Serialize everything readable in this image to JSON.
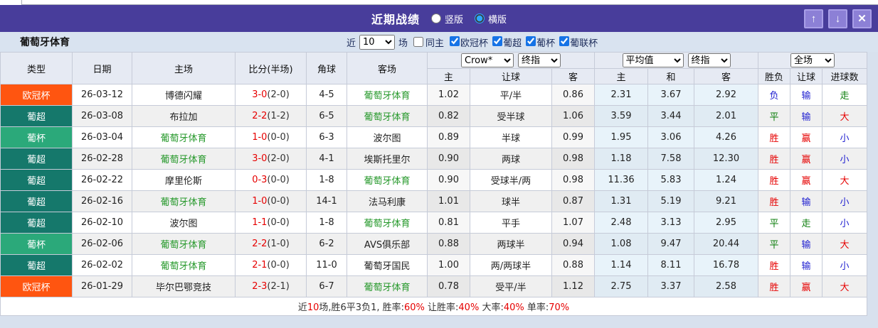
{
  "titlebar": {
    "title": "近期战绩",
    "radio_vertical": "竖版",
    "radio_horizontal": "横版",
    "selected_layout": "横版",
    "icons": {
      "up": "↑",
      "down": "↓",
      "close": "✕"
    },
    "bar_color": "#483d9b"
  },
  "filterbar": {
    "team": "葡萄牙体育",
    "near_label": "近",
    "count_value": "10",
    "matches_label": "场",
    "same_home_label": "同主",
    "same_home_checked": false,
    "leagues": [
      {
        "label": "欧冠杯",
        "checked": true
      },
      {
        "label": "葡超",
        "checked": true
      },
      {
        "label": "葡杯",
        "checked": true
      },
      {
        "label": "葡联杯",
        "checked": true
      }
    ]
  },
  "table": {
    "headers": {
      "type": "类型",
      "date": "日期",
      "home": "主场",
      "score": "比分(半场)",
      "corner": "角球",
      "away": "客场",
      "sub": [
        "主",
        "让球",
        "客",
        "主",
        "和",
        "客",
        "胜负",
        "让球",
        "进球数"
      ]
    },
    "selects": {
      "book": "Crow*",
      "book_ref": "终指",
      "avg": "平均值",
      "avg_ref": "终指",
      "scope": "全场"
    },
    "type_colors": {
      "欧冠杯": "#ff5510",
      "葡超": "#15786b",
      "葡杯": "#2ba97a"
    },
    "result_colors": {
      "red": "#e60000",
      "green": "#0a7d0a",
      "blue": "#2020d0"
    },
    "focus_team_color": "#27992c",
    "score_color": "#e60000",
    "rows": [
      {
        "league": "欧冠杯",
        "cls": "ucl",
        "date": "26-03-12",
        "home": "博德闪耀",
        "hf": false,
        "score": "3-0",
        "half": "(2-0)",
        "corner": "4-5",
        "away": "葡萄牙体育",
        "af": true,
        "o": [
          "1.02",
          "平/半",
          "0.86"
        ],
        "a": [
          "2.31",
          "3.67",
          "2.92"
        ],
        "r": [
          [
            "负",
            "b"
          ],
          [
            "输",
            "b"
          ],
          [
            "走",
            "g"
          ]
        ]
      },
      {
        "league": "葡超",
        "cls": "liga",
        "date": "26-03-08",
        "home": "布拉加",
        "hf": false,
        "score": "2-2",
        "half": "(1-2)",
        "corner": "6-5",
        "away": "葡萄牙体育",
        "af": true,
        "o": [
          "0.82",
          "受半球",
          "1.06"
        ],
        "a": [
          "3.59",
          "3.44",
          "2.01"
        ],
        "r": [
          [
            "平",
            "g"
          ],
          [
            "输",
            "b"
          ],
          [
            "大",
            "r"
          ]
        ]
      },
      {
        "league": "葡杯",
        "cls": "cup",
        "date": "26-03-04",
        "home": "葡萄牙体育",
        "hf": true,
        "score": "1-0",
        "half": "(0-0)",
        "corner": "6-3",
        "away": "波尔图",
        "af": false,
        "o": [
          "0.89",
          "半球",
          "0.99"
        ],
        "a": [
          "1.95",
          "3.06",
          "4.26"
        ],
        "r": [
          [
            "胜",
            "r"
          ],
          [
            "赢",
            "r"
          ],
          [
            "小",
            "b"
          ]
        ]
      },
      {
        "league": "葡超",
        "cls": "liga",
        "date": "26-02-28",
        "home": "葡萄牙体育",
        "hf": true,
        "score": "3-0",
        "half": "(2-0)",
        "corner": "4-1",
        "away": "埃斯托里尔",
        "af": false,
        "o": [
          "0.90",
          "两球",
          "0.98"
        ],
        "a": [
          "1.18",
          "7.58",
          "12.30"
        ],
        "r": [
          [
            "胜",
            "r"
          ],
          [
            "赢",
            "r"
          ],
          [
            "小",
            "b"
          ]
        ]
      },
      {
        "league": "葡超",
        "cls": "liga",
        "date": "26-02-22",
        "home": "摩里伦斯",
        "hf": false,
        "score": "0-3",
        "half": "(0-0)",
        "corner": "1-8",
        "away": "葡萄牙体育",
        "af": true,
        "o": [
          "0.90",
          "受球半/两",
          "0.98"
        ],
        "a": [
          "11.36",
          "5.83",
          "1.24"
        ],
        "r": [
          [
            "胜",
            "r"
          ],
          [
            "赢",
            "r"
          ],
          [
            "大",
            "r"
          ]
        ]
      },
      {
        "league": "葡超",
        "cls": "liga",
        "date": "26-02-16",
        "home": "葡萄牙体育",
        "hf": true,
        "score": "1-0",
        "half": "(0-0)",
        "corner": "14-1",
        "away": "法马利康",
        "af": false,
        "o": [
          "1.01",
          "球半",
          "0.87"
        ],
        "a": [
          "1.31",
          "5.19",
          "9.21"
        ],
        "r": [
          [
            "胜",
            "r"
          ],
          [
            "输",
            "b"
          ],
          [
            "小",
            "b"
          ]
        ]
      },
      {
        "league": "葡超",
        "cls": "liga",
        "date": "26-02-10",
        "home": "波尔图",
        "hf": false,
        "score": "1-1",
        "half": "(0-0)",
        "corner": "1-8",
        "away": "葡萄牙体育",
        "af": true,
        "o": [
          "0.81",
          "平手",
          "1.07"
        ],
        "a": [
          "2.48",
          "3.13",
          "2.95"
        ],
        "r": [
          [
            "平",
            "g"
          ],
          [
            "走",
            "g"
          ],
          [
            "小",
            "b"
          ]
        ]
      },
      {
        "league": "葡杯",
        "cls": "cup",
        "date": "26-02-06",
        "home": "葡萄牙体育",
        "hf": true,
        "score": "2-2",
        "half": "(1-0)",
        "corner": "6-2",
        "away": "AVS俱乐部",
        "af": false,
        "o": [
          "0.88",
          "两球半",
          "0.94"
        ],
        "a": [
          "1.08",
          "9.47",
          "20.44"
        ],
        "r": [
          [
            "平",
            "g"
          ],
          [
            "输",
            "b"
          ],
          [
            "大",
            "r"
          ]
        ]
      },
      {
        "league": "葡超",
        "cls": "liga",
        "date": "26-02-02",
        "home": "葡萄牙体育",
        "hf": true,
        "score": "2-1",
        "half": "(0-0)",
        "corner": "11-0",
        "away": "葡萄牙国民",
        "af": false,
        "o": [
          "1.00",
          "两/两球半",
          "0.88"
        ],
        "a": [
          "1.14",
          "8.11",
          "16.78"
        ],
        "r": [
          [
            "胜",
            "r"
          ],
          [
            "输",
            "b"
          ],
          [
            "小",
            "b"
          ]
        ]
      },
      {
        "league": "欧冠杯",
        "cls": "ucl",
        "date": "26-01-29",
        "home": "毕尔巴鄂竞技",
        "hf": false,
        "score": "2-3",
        "half": "(2-1)",
        "corner": "6-7",
        "away": "葡萄牙体育",
        "af": true,
        "o": [
          "0.78",
          "受平/半",
          "1.12"
        ],
        "a": [
          "2.75",
          "3.37",
          "2.58"
        ],
        "r": [
          [
            "胜",
            "r"
          ],
          [
            "赢",
            "r"
          ],
          [
            "大",
            "r"
          ]
        ]
      }
    ]
  },
  "summary": {
    "segments": [
      [
        "近",
        "d"
      ],
      [
        "10",
        "r"
      ],
      [
        "场,胜6平3负1, 胜率:",
        "d"
      ],
      [
        "60%",
        "r"
      ],
      [
        " 让胜率:",
        "d"
      ],
      [
        "40%",
        "r"
      ],
      [
        " 大率:",
        "d"
      ],
      [
        "40%",
        "r"
      ],
      [
        " 单率:",
        "d"
      ],
      [
        "70%",
        "r"
      ]
    ]
  }
}
